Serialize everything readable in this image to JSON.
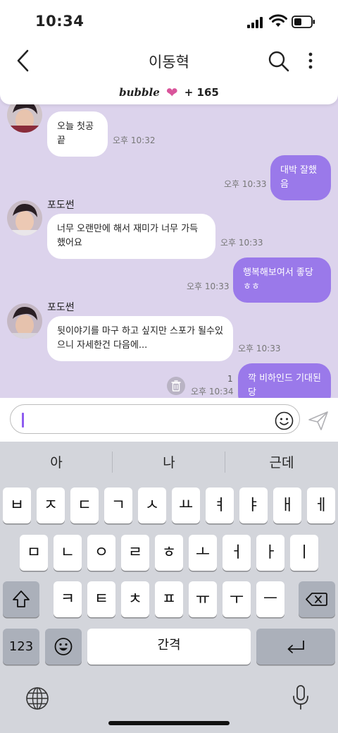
{
  "status_bar": {
    "time": "10:34"
  },
  "header": {
    "title": "이동혁",
    "back_icon": "chevron-left-icon",
    "search_icon": "search-icon",
    "more_icon": "more-vertical-icon"
  },
  "banner": {
    "brand": "bubble",
    "icon": "heart-icon",
    "count": "+ 165",
    "heart_color": "#d9559b"
  },
  "chat": {
    "bg_color": "#dcd3ec",
    "outgoing_color": "#9a79ea",
    "messages": [
      {
        "side": "in",
        "sender": "",
        "text": "오늘 첫공끝",
        "time": "오후 10:32"
      },
      {
        "side": "out",
        "text": "대박 잘했음",
        "time": "오후 10:33"
      },
      {
        "side": "in",
        "sender": "포도썬",
        "text": "너무 오랜만에 해서 재미가 너무 가득했어요",
        "time": "오후 10:33"
      },
      {
        "side": "out",
        "text": "행복해보여서 좋당ㅎㅎ",
        "time": "오후 10:33"
      },
      {
        "side": "in",
        "sender": "포도썬",
        "text": "뒷이야기를 마구 하고 싶지만 스포가 될수있으니 자세한건 다음에...",
        "time": "오후 10:33"
      },
      {
        "side": "out",
        "text": "깍 비하인드 기대된당",
        "time": "오후 10:34",
        "unread": "1"
      }
    ]
  },
  "input": {
    "placeholder": "",
    "emoji_icon": "smiley-icon",
    "send_icon": "send-icon",
    "caret_color": "#8e5cf0"
  },
  "keyboard": {
    "suggestions": [
      "아",
      "나",
      "근데"
    ],
    "row1": [
      "ㅂ",
      "ㅈ",
      "ㄷ",
      "ㄱ",
      "ㅅ",
      "ㅛ",
      "ㅕ",
      "ㅑ",
      "ㅐ",
      "ㅔ"
    ],
    "row2": [
      "ㅁ",
      "ㄴ",
      "ㅇ",
      "ㄹ",
      "ㅎ",
      "ㅗ",
      "ㅓ",
      "ㅏ",
      "ㅣ"
    ],
    "row3": [
      "ㅋ",
      "ㅌ",
      "ㅊ",
      "ㅍ",
      "ㅠ",
      "ㅜ",
      "ㅡ"
    ],
    "shift_icon": "shift-icon",
    "delete_icon": "backspace-icon",
    "numbers_label": "123",
    "emoji_key_icon": "emoji-icon",
    "space_label": "간격",
    "return_icon": "return-icon",
    "globe_icon": "globe-icon",
    "mic_icon": "microphone-icon"
  }
}
